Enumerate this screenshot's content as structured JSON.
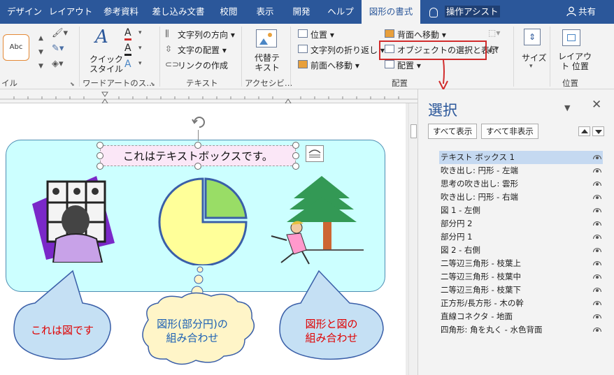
{
  "tabs": [
    {
      "label": "デザイン",
      "active": false
    },
    {
      "label": "レイアウト",
      "active": false
    },
    {
      "label": "参考資料",
      "active": false
    },
    {
      "label": "差し込み文書",
      "active": false
    },
    {
      "label": "校閲",
      "active": false
    },
    {
      "label": "表示",
      "active": false
    },
    {
      "label": "開発",
      "active": false
    },
    {
      "label": "ヘルプ",
      "active": false
    },
    {
      "label": "図形の書式",
      "active": true
    }
  ],
  "tellme": "操作アシスト",
  "share": "共有",
  "ribbon": {
    "style_sample": "Abc",
    "quick_style": "クイック\nスタイル",
    "text_direction": "文字列の方向",
    "text_align": "文字の配置",
    "create_link": "リンクの作成",
    "alt_text": "代替テ\nキスト",
    "position": "位置",
    "wrap_text": "文字列の折り返し",
    "bring_forward": "前面へ移動",
    "send_backward": "背面へ移動",
    "selection_pane": "オブジェクトの選択と表示",
    "align": "配置",
    "size": "サイズ",
    "layout_position": "レイアウ\nト 位置",
    "groups": {
      "shape_styles": "イル",
      "wordart": "ワードアートのス…",
      "text": "テキスト",
      "accessibility": "アクセシビ…",
      "arrange": "配置",
      "position_grp": "位置"
    }
  },
  "document": {
    "textbox_text": "これはテキストボックスです。",
    "callout_left": "これは図です",
    "callout_mid": "図形(部分円)の\n組み合わせ",
    "callout_right": "図形と図の\n組み合わせ"
  },
  "selection_pane": {
    "title": "選択",
    "show_all": "すべて表示",
    "hide_all": "すべて非表示",
    "items": [
      "テキスト ボックス 1",
      "吹き出し: 円形 - 左端",
      "思考の吹き出し: 雲形",
      "吹き出し: 円形 - 右端",
      "図 1 - 左側",
      "部分円 2",
      "部分円 1",
      "図 2 - 右側",
      "二等辺三角形 - 枝葉上",
      "二等辺三角形 - 枝葉中",
      "二等辺三角形 - 枝葉下",
      "正方形/長方形 - 木の幹",
      "直線コネクタ - 地面",
      "四角形: 角を丸く - 水色背面"
    ],
    "selected_index": 0
  },
  "colors": {
    "accent": "#2b579a",
    "highlight": "#d12b2b",
    "bg_shape": "#ccffff"
  }
}
